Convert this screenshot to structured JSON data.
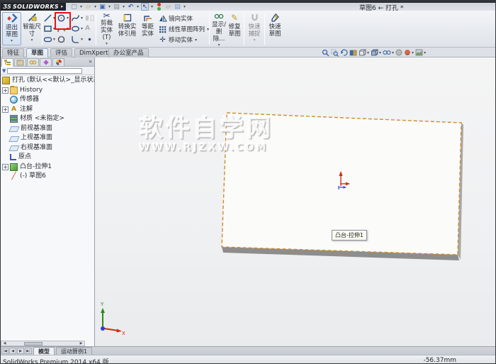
{
  "window": {
    "logo_mark": "ƷS",
    "logo": "SOLIDWORKS",
    "title": "草图6 ← 打孔 *"
  },
  "glyphs": {
    "caret": "▾",
    "plus": "+",
    "chevrons": "»",
    "funnel": "▼",
    "arrow_left": "◀",
    "arrow_right": "▶",
    "nav_first": "|◀",
    "nav_prev": "◀",
    "nav_next": "▶",
    "nav_last": "▶|",
    "page": "▢",
    "folder": "▱",
    "disk": "▣",
    "printer": "▤",
    "undo": "↶",
    "cursor": "↖",
    "flyout": "▸",
    "scissors": "✂",
    "pencil": "✎",
    "move_cross": "✛",
    "letter_a": "A",
    "sketch_stroke": "╱",
    "bullet": "•"
  },
  "qat_icons": [
    "new-document-icon",
    "open-icon",
    "save-icon",
    "print-icon",
    "undo-icon",
    "select-cursor-icon",
    "rebuild-icon",
    "appearance-icon",
    "scene-icon"
  ],
  "ribbon": {
    "exit_sketch": "退出草图",
    "smart_dimension": "智能尺寸",
    "trim": "剪裁实体(T)",
    "convert": "转换实体引用",
    "offset": "等距实体",
    "mirror": "镜向实体",
    "linear_pattern": "线性草图阵列",
    "move": "移动实体",
    "display_delete": "显示/删除...",
    "repair": "修复草图",
    "quick_snaps": "快速捕捉",
    "rapid_sketch": "快速草图",
    "sketch_tools": [
      "line",
      "circle",
      "spline",
      "mirror-entities",
      "rectangle",
      "arc",
      "ellipse",
      "text",
      "slot",
      "perimeter-circle",
      "fillet",
      "point"
    ],
    "highlight_box_color": "#e31414"
  },
  "command_tabs": {
    "items": [
      {
        "label": "特征"
      },
      {
        "label": "草图",
        "active": true
      },
      {
        "label": "评估"
      },
      {
        "label": "DimXpert"
      },
      {
        "label": "办公室产品"
      }
    ]
  },
  "headsup_icons": [
    "zoom-fit-icon",
    "zoom-area-icon",
    "previous-view-icon",
    "section-view-icon",
    "view-orientation-icon",
    "display-style-icon",
    "hide-show-items-icon",
    "edit-appearance-icon",
    "apply-scene-icon",
    "view-settings-icon"
  ],
  "panel": {
    "tab_icons": [
      "featuremanager-tab-icon",
      "propertymanager-tab-icon",
      "configurationmanager-tab-icon",
      "dimxpertmanager-tab-icon",
      "displaymanager-tab-icon"
    ]
  },
  "tree": {
    "items": [
      {
        "label": "打孔 (默认<<默认>_显示状态",
        "icon": "part",
        "root": true
      },
      {
        "label": "History",
        "icon": "folder",
        "expand": true
      },
      {
        "label": "传感器",
        "icon": "sensor"
      },
      {
        "label": "注解",
        "icon": "annotations",
        "expand": true
      },
      {
        "label": "材质 <未指定>",
        "icon": "material"
      },
      {
        "label": "前视基准面",
        "icon": "plane"
      },
      {
        "label": "上视基准面",
        "icon": "plane"
      },
      {
        "label": "右视基准面",
        "icon": "plane"
      },
      {
        "label": "原点",
        "icon": "origin"
      },
      {
        "label": "凸台-拉伸1",
        "icon": "extrude",
        "expand": true
      },
      {
        "label": "(-) 草图6",
        "icon": "sketch"
      }
    ]
  },
  "viewport": {
    "tooltip": "凸台-拉伸1",
    "watermark": {
      "line1": "软件自学网",
      "line2": "WWW.RJZXW.COM"
    },
    "triad": {
      "x": "X",
      "y": "Y"
    },
    "plate_edge_color": "#cf8a2e",
    "axis_colors": {
      "x_red": "#d42a10",
      "y_green": "#2a8a1a",
      "z_blue": "#2a3fd4"
    }
  },
  "model_tabs": {
    "items": [
      {
        "label": "模型",
        "active": true
      },
      {
        "label": "运动算例1"
      }
    ]
  },
  "statusbar": {
    "left": "SolidWorks Premium 2014 x64 版",
    "right": "-56.37mm"
  }
}
